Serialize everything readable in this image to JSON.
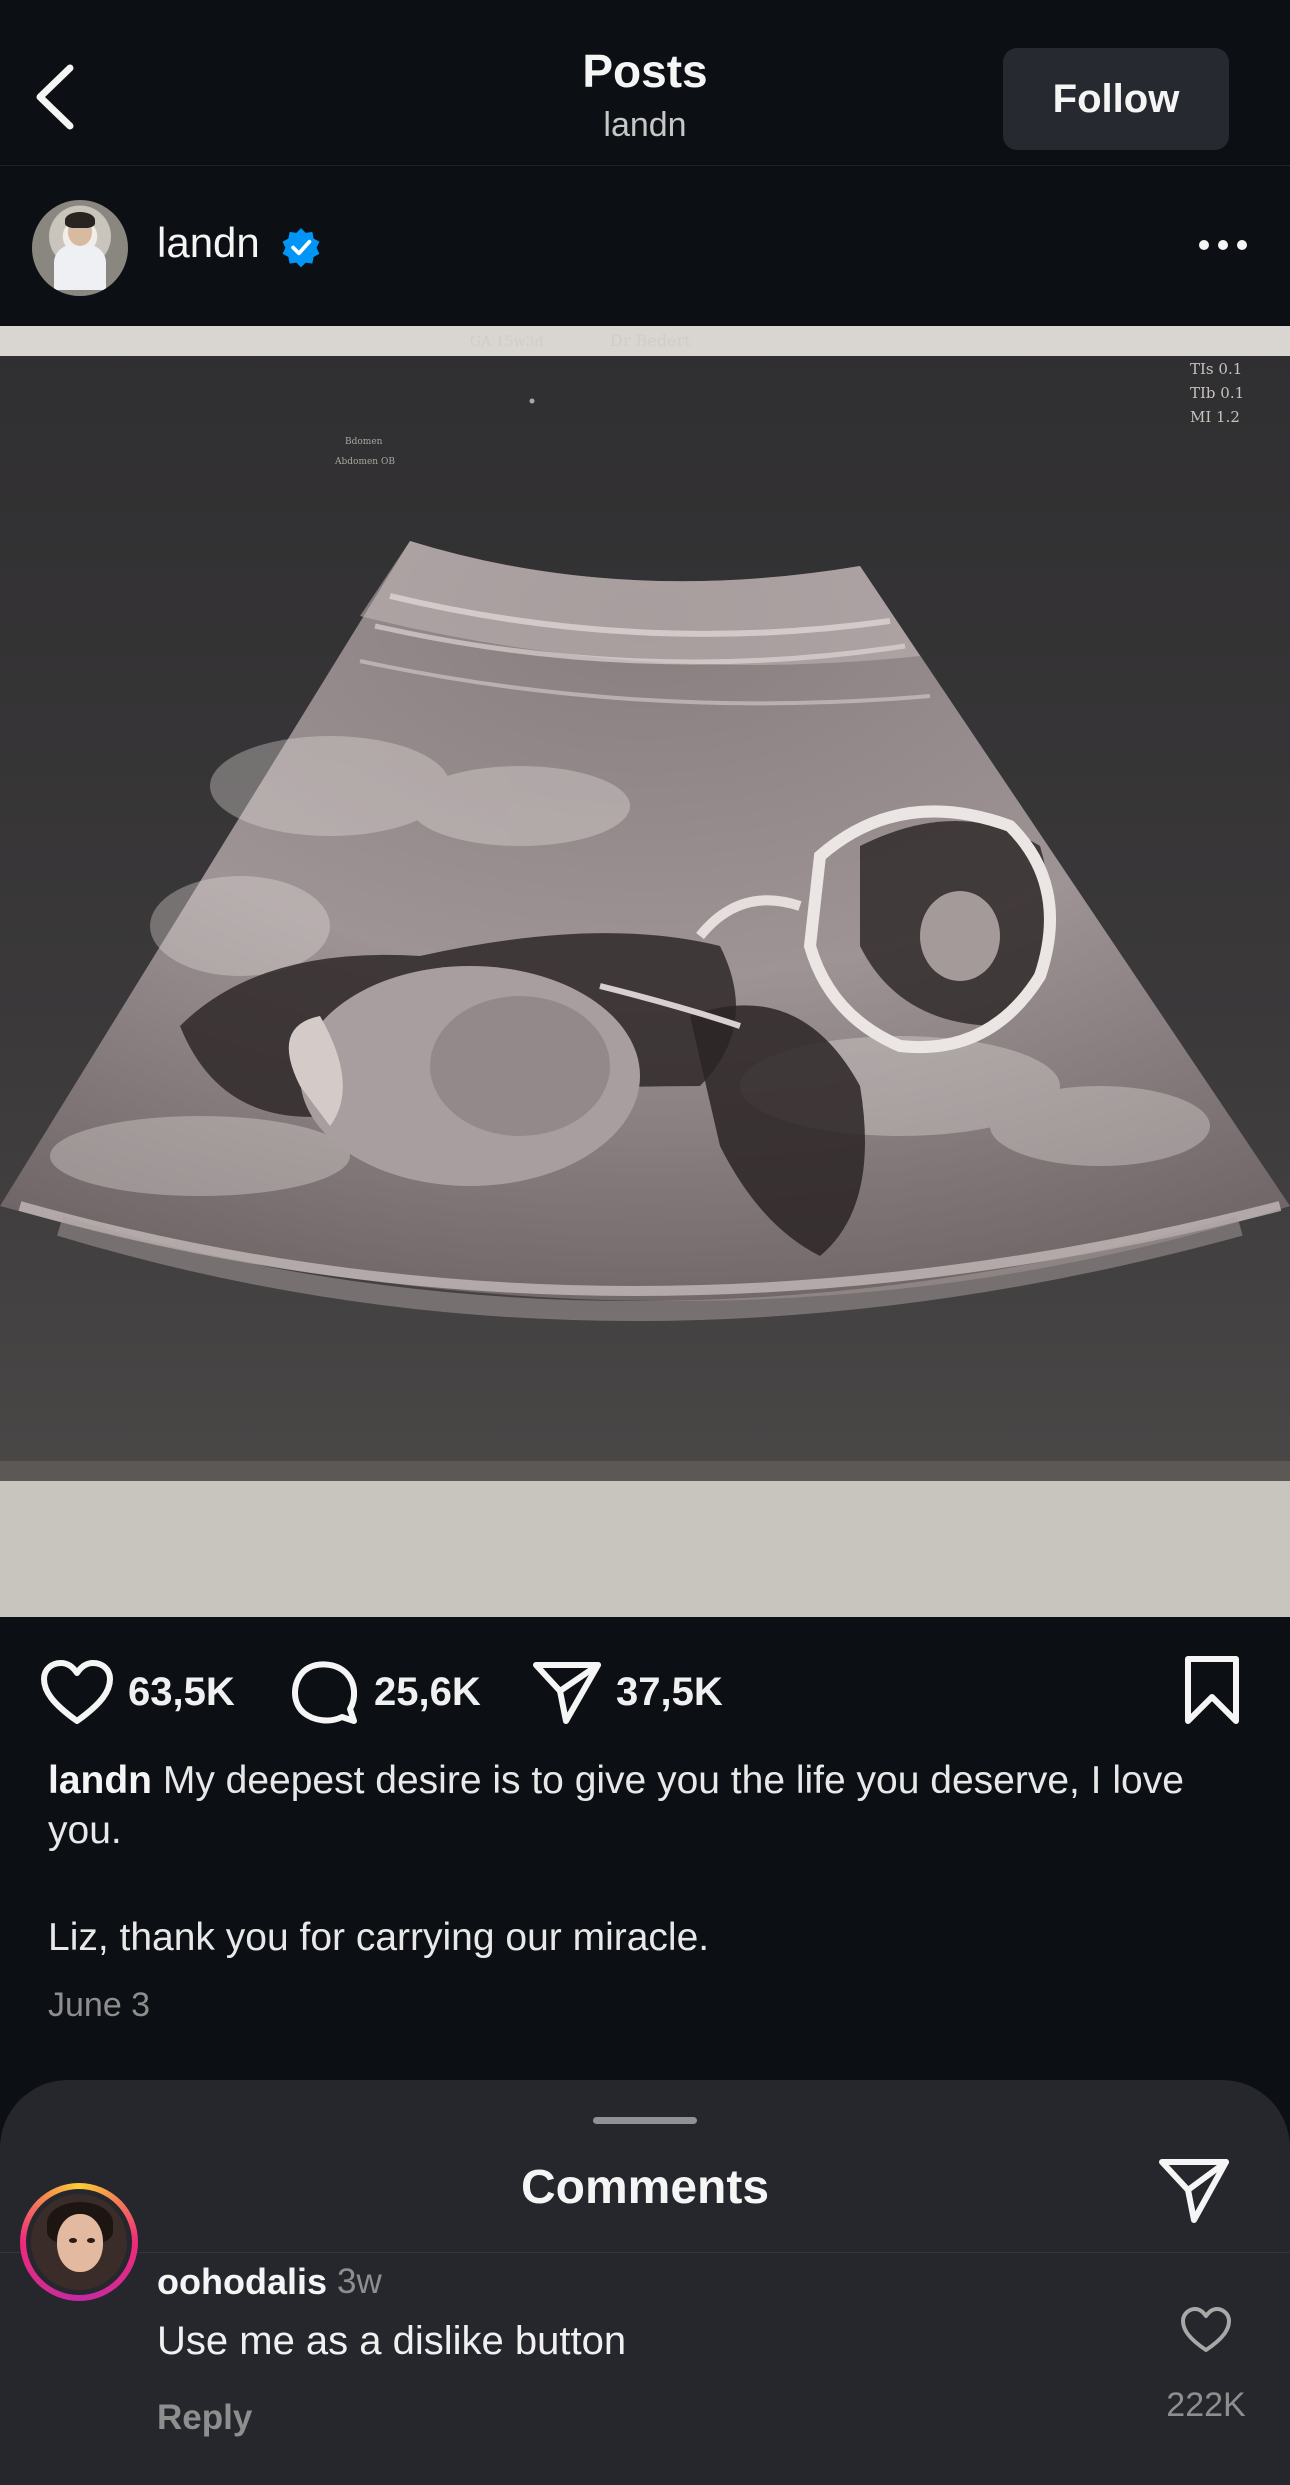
{
  "header": {
    "title": "Posts",
    "subtitle": "landn",
    "follow_label": "Follow",
    "back_icon": "chevron-left-icon"
  },
  "author": {
    "username": "landn",
    "verified": true,
    "more_icon": "more-horizontal-icon"
  },
  "post": {
    "image_alt": "ultrasound-photo",
    "ultrasound_text": {
      "top_left": "GA 15w3d",
      "top_mid": "Dr Bedert",
      "top_right_1": "TIs 0.1",
      "top_right_2": "TIb 0.1",
      "top_right_3": "MI 1.2",
      "left_label_1": "Bdomen",
      "left_label_2": "Abdomen OB"
    },
    "likes": "63,5K",
    "comments": "25,6K",
    "shares": "37,5K",
    "caption_user": "landn",
    "caption_text": "My deepest desire is to give you the life you deserve, I love you.",
    "caption_text_2": "Liz, thank you for carrying our miracle.",
    "date": "June 3"
  },
  "comments_sheet": {
    "title": "Comments",
    "share_icon": "send-icon",
    "items": [
      {
        "username": "oohodalis",
        "time": "3w",
        "text": "Use me as a dislike button",
        "reply_label": "Reply",
        "like_count": "222K"
      }
    ]
  },
  "colors": {
    "background": "#0c1014",
    "sheet": "#25272d",
    "verified": "#0095f6",
    "follow_button": "#262a30"
  }
}
